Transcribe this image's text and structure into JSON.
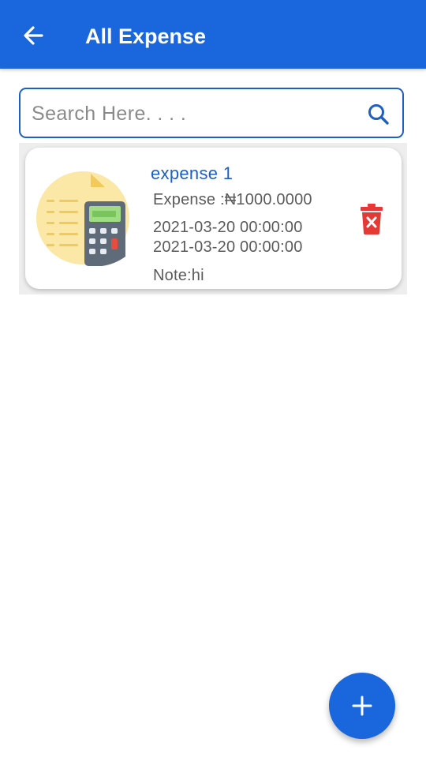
{
  "header": {
    "title": "All Expense",
    "back_icon": "arrow-left-icon",
    "color": "#1a66dc"
  },
  "search": {
    "placeholder": "Search Here. . . .",
    "value": "",
    "icon": "search-icon"
  },
  "expenses": [
    {
      "title": "expense 1",
      "amount_text": "Expense :₦1000.0000",
      "date_1": "2021-03-20 00:00:00",
      "date_2": "2021-03-20 00:00:00",
      "note_text": "Note:hi",
      "thumbnail_icon": "receipt-calculator-icon",
      "delete_icon": "trash-icon"
    }
  ],
  "fab": {
    "label": "+",
    "icon": "plus-icon"
  },
  "colors": {
    "accent": "#1a66dc",
    "delete": "#e53935"
  }
}
